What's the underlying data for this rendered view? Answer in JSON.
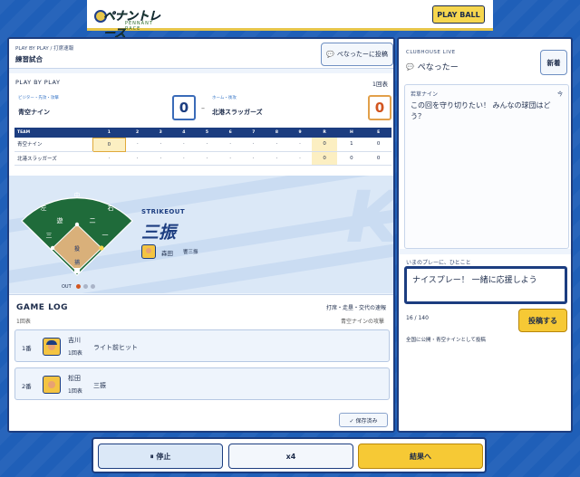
{
  "header": {
    "logo_text": "ペナントレース",
    "logo_sub": "PENNANT RACE",
    "play_ball_label": "PLAY BALL"
  },
  "main": {
    "breadcrumb": "PLAY BY PLAY / 打席速報",
    "match_title": "練習試合",
    "post_button_label": "ぺなったーに投稿",
    "play_by_play_label": "PLAY BY PLAY",
    "inning_label": "1回表",
    "away": {
      "role": "ビジター・先攻・攻撃",
      "name": "青空ナイン",
      "score": "0"
    },
    "home": {
      "role": "ホーム・後攻",
      "name": "北港スラッガーズ",
      "score": "0"
    },
    "dash": "–"
  },
  "boxscore": {
    "headers": [
      "TEAM",
      "1",
      "2",
      "3",
      "4",
      "5",
      "6",
      "7",
      "8",
      "9",
      "R",
      "H",
      "E"
    ],
    "rows": [
      {
        "team": "青空ナイン",
        "cells": [
          "0",
          "·",
          "·",
          "·",
          "·",
          "·",
          "·",
          "·",
          "·",
          "0",
          "1",
          "0"
        ]
      },
      {
        "team": "北港スラッガーズ",
        "cells": [
          "·",
          "·",
          "·",
          "·",
          "·",
          "·",
          "·",
          "·",
          "·",
          "0",
          "0",
          "0"
        ]
      }
    ]
  },
  "field": {
    "positions": {
      "cf": "中",
      "lf": "左",
      "rf": "右",
      "ss": "遊",
      "second": "二",
      "third": "三",
      "first": "一",
      "pitcher": "投",
      "catcher": "捕"
    },
    "event_label": "STRIKEOUT",
    "event_big": "三振",
    "batter_name": "森田",
    "batter_detail": "響三振",
    "out_label": "OUT",
    "outs": 1,
    "outs_max": 3,
    "backdrop_letter": "K"
  },
  "game_log": {
    "title": "GAME LOG",
    "note": "打席・走塁・交代の速報",
    "cut_left": "1回表",
    "cut_right": "青空ナインの攻撃",
    "items": [
      {
        "order": "1番",
        "name": "吉川",
        "inning": "1回表",
        "result": "ライト前ヒット"
      },
      {
        "order": "2番",
        "name": "松田",
        "inning": "1回表",
        "result": "三振"
      }
    ],
    "saved_label": "✓ 保存済み"
  },
  "clubhouse": {
    "label": "CLUBHOUSE LIVE",
    "name": "ぺなったー",
    "new_label": "新着",
    "post_user": "若草ナイン",
    "post_time": "今",
    "post_text": "この回を守り切りたい！ みんなの球団はどう？",
    "say_label": "いまのプレーに、ひとこと",
    "input_value": "ナイスプレー！ 一緒に応援しよう",
    "char_count": "16 / 140",
    "submit_label": "投稿する",
    "visibility": "全国に公開・青空ナインとして投稿"
  },
  "controls": {
    "pause_label": "⏸ 停止",
    "speed_label": "x4",
    "result_label": "結果へ"
  },
  "colors": {
    "navy": "#1c3d80",
    "accent_yellow": "#f6c935",
    "home_score": "#d2551f",
    "background_blue": "#1f5fb8"
  }
}
